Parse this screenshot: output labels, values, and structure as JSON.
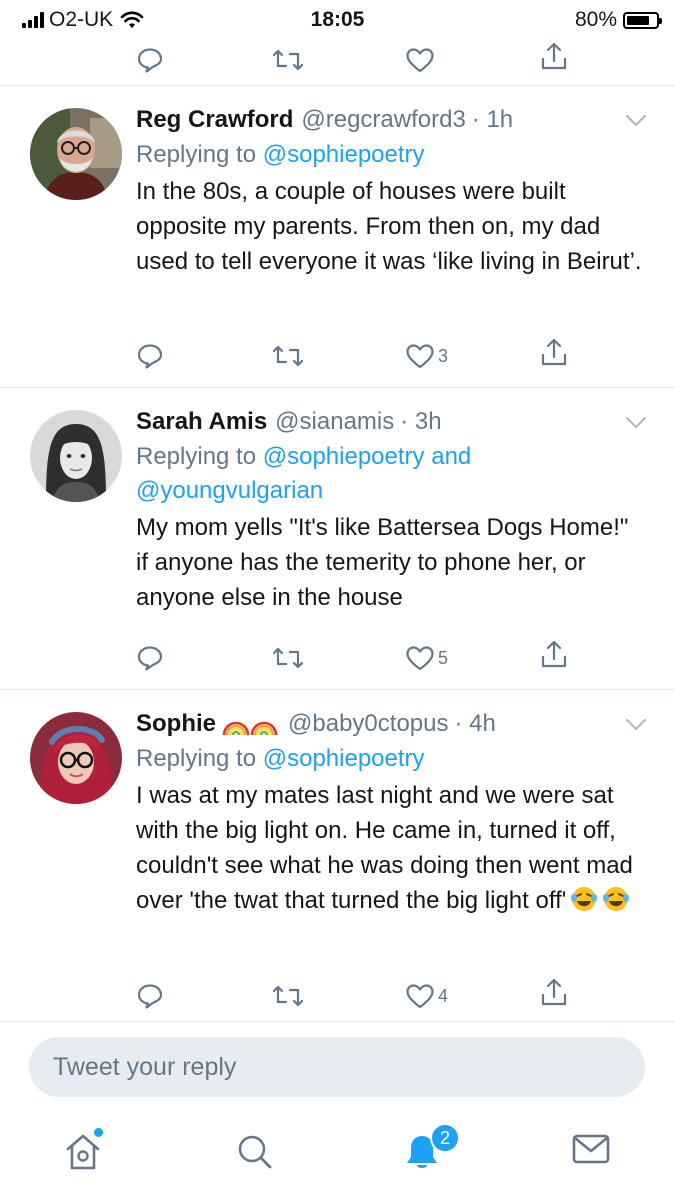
{
  "status_bar": {
    "carrier": "O2-UK",
    "time": "18:05",
    "battery_pct": "80%",
    "battery_level": 0.8
  },
  "tweets": [
    {
      "display_name": "Reg Crawford",
      "handle": "@regcrawford3",
      "time": "· 1h",
      "replying_label": "Replying to",
      "replying_to": "@sophiepoetry",
      "replying_and": "",
      "replying_to_2": "",
      "text": "In the 80s, a couple of houses were built opposite my parents. From then on, my dad used to tell everyone it was ‘like living in Beirut’.",
      "like_count": "3"
    },
    {
      "display_name": "Sarah Amis",
      "handle": "@sianamis",
      "time": "· 3h",
      "replying_label": "Replying to",
      "replying_to": "@sophiepoetry",
      "replying_and": "and",
      "replying_to_2": "@youngvulgarian",
      "text": "My mom yells \"It's like Battersea Dogs Home!\" if anyone has the temerity to phone her, or anyone else in the house",
      "like_count": "5"
    },
    {
      "display_name": "Sophie",
      "handle": "@baby0ctopus",
      "time": "· 4h",
      "replying_label": "Replying to",
      "replying_to": "@sophiepoetry",
      "replying_and": "",
      "replying_to_2": "",
      "text": "I was at my mates last night and we were sat with the big light on. He came in, turned it off, couldn't see what he was doing then went mad over 'the twat that turned the big light off'",
      "like_count": "4"
    }
  ],
  "reply_box": {
    "placeholder": "Tweet your reply"
  },
  "tab_bar": {
    "notifications_badge": "2"
  },
  "colors": {
    "accent": "#1da1f2",
    "secondary_text": "#657786",
    "divider": "#e1e8ed",
    "reply_bg": "#e6ecf0"
  }
}
